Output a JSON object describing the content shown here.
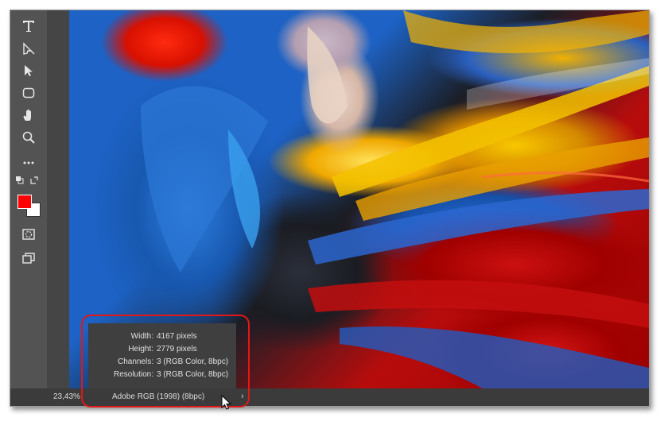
{
  "tools": [
    {
      "name": "type-tool-icon"
    },
    {
      "name": "path-selection-tool-icon"
    },
    {
      "name": "direct-selection-tool-icon"
    },
    {
      "name": "rectangle-tool-icon"
    },
    {
      "name": "hand-tool-icon"
    },
    {
      "name": "zoom-tool-icon"
    },
    {
      "name": "more-tools-icon"
    }
  ],
  "colors": {
    "foreground": "#ff0000",
    "background": "#ffffff",
    "highlight_outline": "#e01818"
  },
  "status_bar": {
    "zoom": "23,43%",
    "color_profile": "Adobe RGB (1998) (8bpc)",
    "expand_arrow": "›"
  },
  "info_popup": {
    "rows": [
      {
        "label": "Width:",
        "value": "4167 pixels"
      },
      {
        "label": "Height:",
        "value": "2779 pixels"
      },
      {
        "label": "Channels:",
        "value": "3 (RGB Color, 8bpc)"
      },
      {
        "label": "Resolution:",
        "value": "3 (RGB Color, 8bpc)"
      }
    ]
  }
}
